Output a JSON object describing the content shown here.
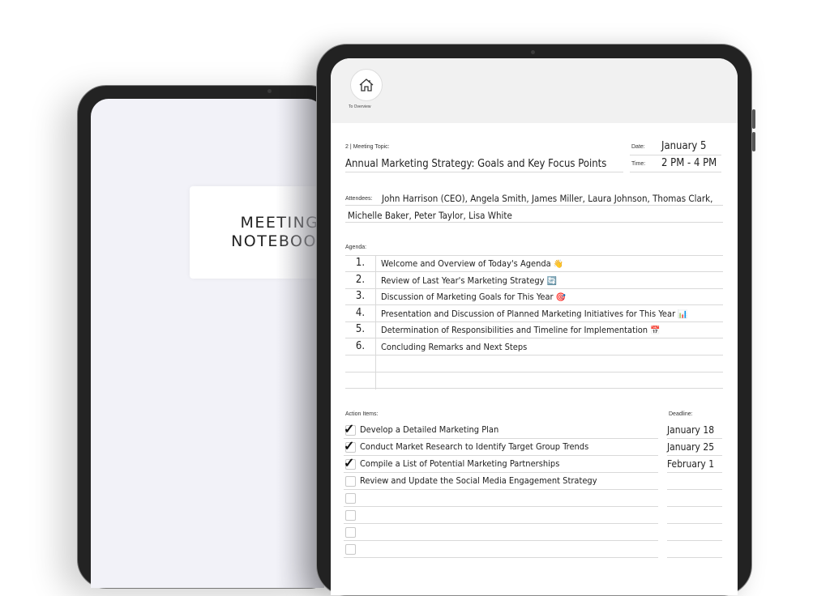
{
  "cover": {
    "title": "MEETING\nNOTEBOOK"
  },
  "nav": {
    "home_icon": "home-icon",
    "home_label": "To Overview"
  },
  "meeting": {
    "topic_label": "2 | Meeting Topic:",
    "topic": "Annual Marketing Strategy: Goals and Key Focus Points",
    "date_label": "Date:",
    "date": "January 5",
    "time_label": "Time:",
    "time": "2 PM - 4 PM",
    "attendees_label": "Attendees:",
    "attendees_line1": "John Harrison (CEO), Angela Smith, James Miller, Laura Johnson, Thomas Clark,",
    "attendees_line2": "Michelle Baker, Peter Taylor, Lisa White"
  },
  "agenda": {
    "label": "Agenda:",
    "items": [
      {
        "num": "1.",
        "text": "Welcome and Overview of Today's Agenda",
        "emoji": "👋"
      },
      {
        "num": "2.",
        "text": "Review of Last Year's Marketing Strategy",
        "emoji": "🔄"
      },
      {
        "num": "3.",
        "text": "Discussion of Marketing Goals for This Year",
        "emoji": "🎯"
      },
      {
        "num": "4.",
        "text": "Presentation and Discussion of Planned Marketing Initiatives for This Year",
        "emoji": "📊"
      },
      {
        "num": "5.",
        "text": "Determination of Responsibilities and Timeline for Implementation",
        "emoji": "📅"
      },
      {
        "num": "6.",
        "text": "Concluding Remarks and Next Steps",
        "emoji": ""
      },
      {
        "num": "",
        "text": "",
        "emoji": ""
      },
      {
        "num": "",
        "text": "",
        "emoji": ""
      }
    ]
  },
  "actions": {
    "label": "Action Items:",
    "deadline_label": "Deadline:",
    "items": [
      {
        "checked": true,
        "text": "Develop a Detailed Marketing Plan",
        "deadline": "January 18"
      },
      {
        "checked": true,
        "text": "Conduct Market Research to Identify Target Group Trends",
        "deadline": "January 25"
      },
      {
        "checked": true,
        "text": "Compile a List of Potential Marketing Partnerships",
        "deadline": "February 1"
      },
      {
        "checked": false,
        "text": "Review and Update the Social Media Engagement Strategy",
        "deadline": ""
      },
      {
        "checked": false,
        "text": "",
        "deadline": ""
      },
      {
        "checked": false,
        "text": "",
        "deadline": ""
      },
      {
        "checked": false,
        "text": "",
        "deadline": ""
      },
      {
        "checked": false,
        "text": "",
        "deadline": ""
      }
    ]
  }
}
